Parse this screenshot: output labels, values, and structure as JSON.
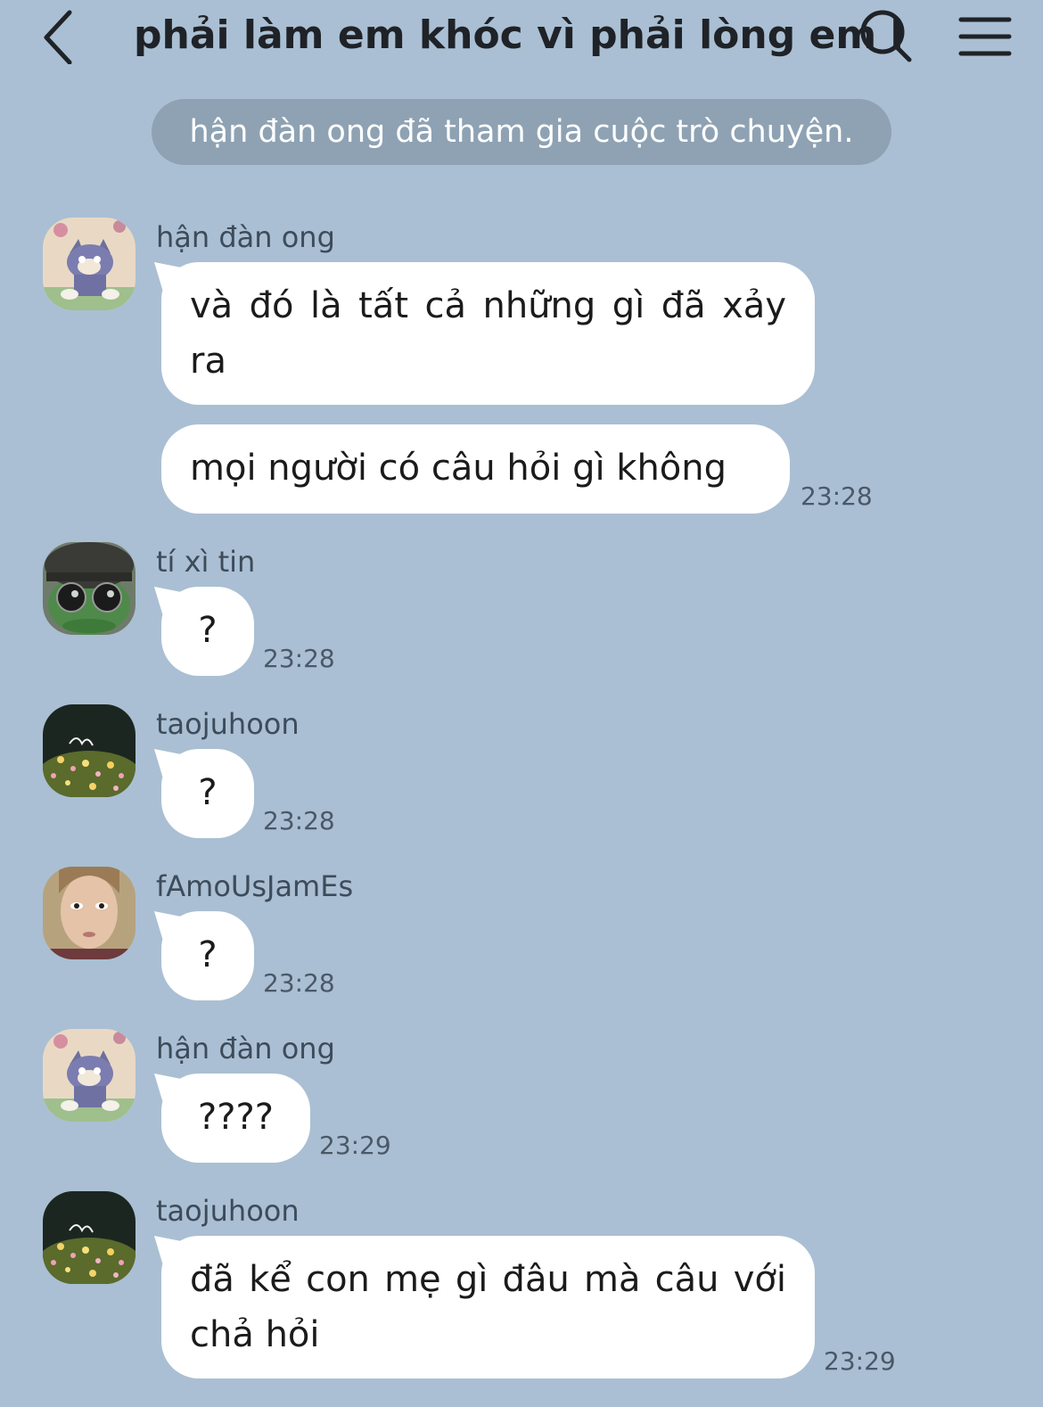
{
  "header": {
    "title": "phải làm em khóc vì phải lòng em khác",
    "back_icon": "chevron-left-icon",
    "search_icon": "search-icon",
    "menu_icon": "menu-icon"
  },
  "system_notice": "hận đàn ong đã tham gia cuộc trò chuyện.",
  "messages": [
    {
      "sender": "hận đàn ong",
      "avatar": "cartoon-cat-avatar",
      "bubbles": [
        "và đó là tất cả những gì đã xảy ra",
        "mọi người có câu hỏi gì không"
      ],
      "time": "23:28"
    },
    {
      "sender": "tí xì tin",
      "avatar": "frog-hat-sunglasses-avatar",
      "bubbles": [
        "?"
      ],
      "time": "23:28"
    },
    {
      "sender": "taojuhoon",
      "avatar": "flowers-night-avatar",
      "bubbles": [
        "?"
      ],
      "time": "23:28"
    },
    {
      "sender": "fAmoUsJamEs",
      "avatar": "face-photo-avatar",
      "bubbles": [
        "?"
      ],
      "time": "23:28"
    },
    {
      "sender": "hận đàn ong",
      "avatar": "cartoon-cat-avatar",
      "bubbles": [
        "????"
      ],
      "time": "23:29"
    },
    {
      "sender": "taojuhoon",
      "avatar": "flowers-night-avatar",
      "bubbles": [
        "đã kể con mẹ gì đâu mà câu với chả hỏi"
      ],
      "time": "23:29"
    }
  ],
  "colors": {
    "background": "#aabfd3",
    "bubble": "#ffffff",
    "notice": "#8ea2b3"
  }
}
